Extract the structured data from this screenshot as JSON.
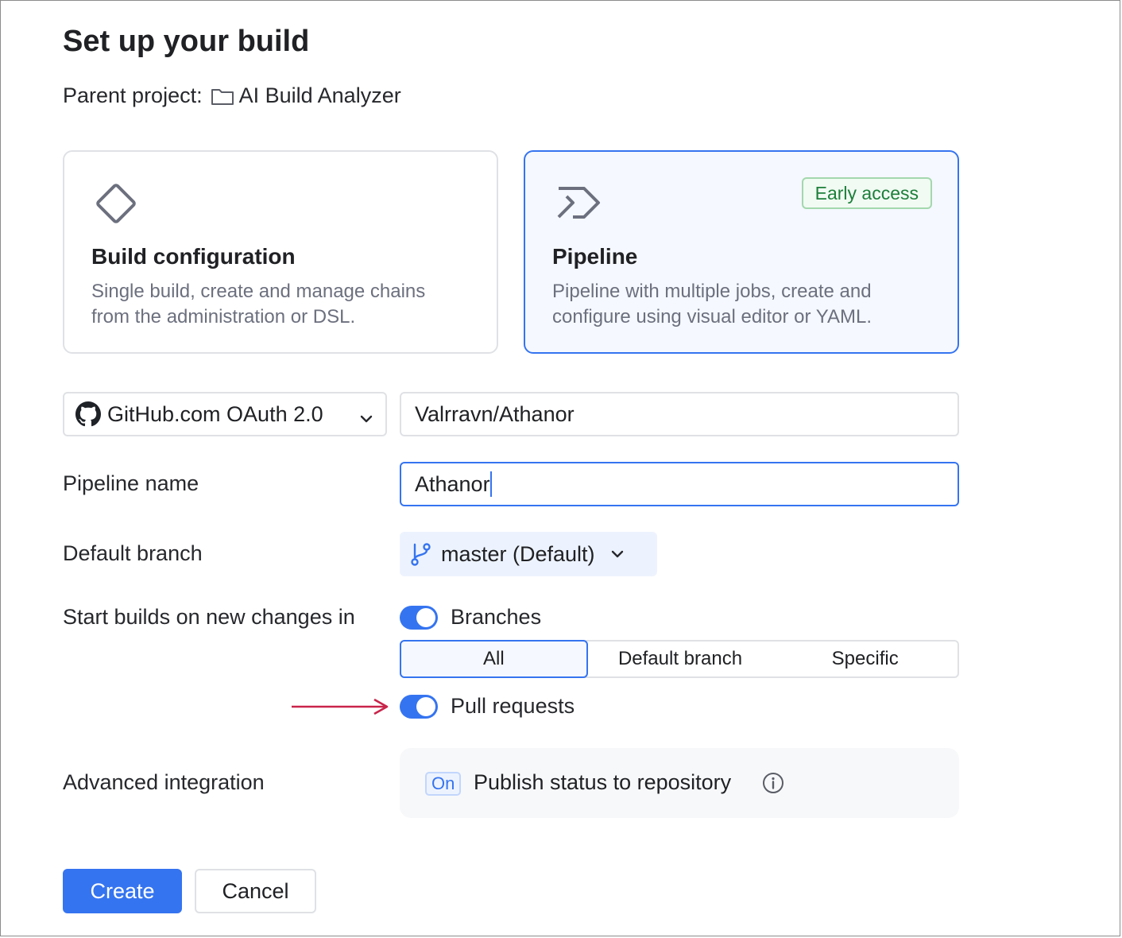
{
  "dialog": {
    "title": "Set up your build",
    "parent_label": "Parent project:",
    "parent_name": "AI Build Analyzer"
  },
  "cards": {
    "build_config": {
      "title": "Build configuration",
      "description": "Single build, create and manage chains from the administration or DSL."
    },
    "pipeline": {
      "title": "Pipeline",
      "description": "Pipeline with multiple jobs, create and configure using visual editor or YAML.",
      "badge": "Early access",
      "selected": true
    }
  },
  "vcs": {
    "provider": "GitHub.com OAuth 2.0",
    "repository": "Valrravn/Athanor"
  },
  "pipeline_name": {
    "label": "Pipeline name",
    "value": "Athanor"
  },
  "default_branch": {
    "label": "Default branch",
    "value": "master (Default)"
  },
  "triggers": {
    "label": "Start builds on new changes in",
    "branches_label": "Branches",
    "branches_on": true,
    "branch_options": [
      "All",
      "Default branch",
      "Specific"
    ],
    "branch_selected": "All",
    "pull_requests_label": "Pull requests",
    "pull_requests_on": true
  },
  "advanced": {
    "label": "Advanced integration",
    "status_chip": "On",
    "publish_label": "Publish status to repository"
  },
  "actions": {
    "create": "Create",
    "cancel": "Cancel"
  },
  "colors": {
    "accent": "#3574f0",
    "badge_green": "#1c7f3a",
    "annotation_arrow": "#c8244a"
  },
  "icons": [
    "folder-icon",
    "diamond-icon",
    "pipeline-icon",
    "github-icon",
    "chevron-down-icon",
    "branch-icon",
    "info-icon",
    "arrow-annotation-icon"
  ]
}
